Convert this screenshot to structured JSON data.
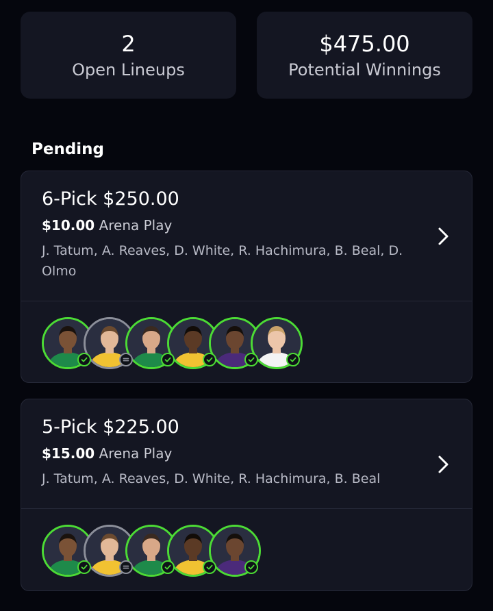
{
  "stats": {
    "open_lineups": {
      "value": "2",
      "label": "Open Lineups"
    },
    "potential_winnings": {
      "value": "$475.00",
      "label": "Potential Winnings"
    }
  },
  "section_title": "Pending",
  "lineups": [
    {
      "title": "6-Pick $250.00",
      "amount": "$10.00",
      "mode": "Arena Play",
      "players": "J. Tatum, A. Reaves, D. White, R. Hachimura, B. Beal, D. Olmo",
      "avatars": [
        {
          "player": "J. Tatum",
          "status": "hit",
          "skin": "#7a5236",
          "jersey": "#1e8a4a",
          "hair": "#1a120d"
        },
        {
          "player": "A. Reaves",
          "status": "push",
          "skin": "#e2b898",
          "jersey": "#f1c232",
          "hair": "#6b4a2f"
        },
        {
          "player": "D. White",
          "status": "hit",
          "skin": "#d8a888",
          "jersey": "#1e8a4a",
          "hair": "#3a2a20"
        },
        {
          "player": "R. Hachimura",
          "status": "hit",
          "skin": "#5b3a25",
          "jersey": "#f1c232",
          "hair": "#120c08"
        },
        {
          "player": "B. Beal",
          "status": "hit",
          "skin": "#6b4630",
          "jersey": "#4b2a7a",
          "hair": "#150f0b"
        },
        {
          "player": "D. Olmo",
          "status": "hit",
          "skin": "#ecc6aa",
          "jersey": "#f4f4f4",
          "hair": "#c9a26a"
        }
      ]
    },
    {
      "title": "5-Pick $225.00",
      "amount": "$15.00",
      "mode": "Arena Play",
      "players": "J. Tatum, A. Reaves, D. White, R. Hachimura, B. Beal",
      "avatars": [
        {
          "player": "J. Tatum",
          "status": "hit",
          "skin": "#7a5236",
          "jersey": "#1e8a4a",
          "hair": "#1a120d"
        },
        {
          "player": "A. Reaves",
          "status": "push",
          "skin": "#e2b898",
          "jersey": "#f1c232",
          "hair": "#6b4a2f"
        },
        {
          "player": "D. White",
          "status": "hit",
          "skin": "#d8a888",
          "jersey": "#1e8a4a",
          "hair": "#3a2a20"
        },
        {
          "player": "R. Hachimura",
          "status": "hit",
          "skin": "#5b3a25",
          "jersey": "#f1c232",
          "hair": "#120c08"
        },
        {
          "player": "B. Beal",
          "status": "hit",
          "skin": "#6b4630",
          "jersey": "#4b2a7a",
          "hair": "#150f0b"
        }
      ]
    }
  ],
  "icons": {
    "chevron": "chevron-right-icon",
    "hit_badge": "check-circle-icon",
    "push_badge": "equals-circle-icon"
  },
  "colors": {
    "background": "#05060d",
    "card": "#141622",
    "hit": "#4cdb35",
    "push": "#8c8f9a"
  }
}
